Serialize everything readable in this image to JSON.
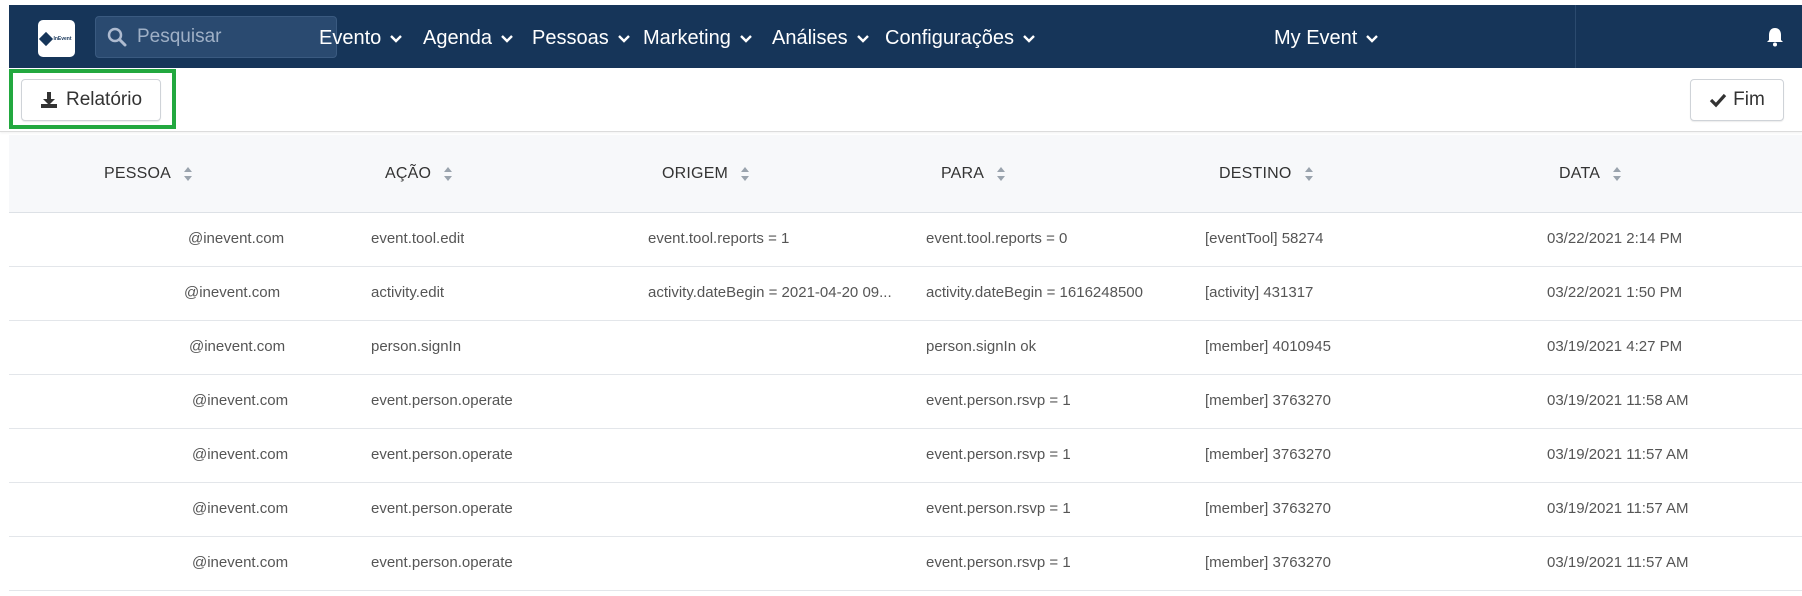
{
  "nav": {
    "logo_text": "InEvent",
    "search_placeholder": "Pesquisar",
    "items": [
      {
        "label": "Evento"
      },
      {
        "label": "Agenda"
      },
      {
        "label": "Pessoas"
      },
      {
        "label": "Marketing"
      },
      {
        "label": "Análises"
      },
      {
        "label": "Configurações"
      }
    ],
    "event_selector": "My Event"
  },
  "toolbar": {
    "report_label": "Relatório",
    "end_label": "Fim"
  },
  "table": {
    "columns": [
      "PESSOA",
      "AÇÃO",
      "ORIGEM",
      "PARA",
      "DESTINO",
      "DATA"
    ],
    "rows": [
      {
        "pessoa": "@inevent.com",
        "acao": "event.tool.edit",
        "origem": "event.tool.reports = 1",
        "para": "event.tool.reports = 0",
        "destino": "[eventTool] 58274",
        "data": "03/22/2021 2:14 PM"
      },
      {
        "pessoa": "@inevent.com",
        "acao": "activity.edit",
        "origem": "activity.dateBegin = 2021-04-20 09...",
        "para": "activity.dateBegin = 1616248500",
        "destino": "[activity] 431317",
        "data": "03/22/2021 1:50 PM"
      },
      {
        "pessoa": "@inevent.com",
        "acao": "person.signIn",
        "origem": "",
        "para": "person.signIn ok",
        "destino": "[member] 4010945",
        "data": "03/19/2021 4:27 PM"
      },
      {
        "pessoa": "@inevent.com",
        "acao": "event.person.operate",
        "origem": "",
        "para": "event.person.rsvp = 1",
        "destino": "[member] 3763270",
        "data": "03/19/2021 11:58 AM"
      },
      {
        "pessoa": "@inevent.com",
        "acao": "event.person.operate",
        "origem": "",
        "para": "event.person.rsvp = 1",
        "destino": "[member] 3763270",
        "data": "03/19/2021 11:57 AM"
      },
      {
        "pessoa": "@inevent.com",
        "acao": "event.person.operate",
        "origem": "",
        "para": "event.person.rsvp = 1",
        "destino": "[member] 3763270",
        "data": "03/19/2021 11:57 AM"
      },
      {
        "pessoa": "@inevent.com",
        "acao": "event.person.operate",
        "origem": "",
        "para": "event.person.rsvp = 1",
        "destino": "[member] 3763270",
        "data": "03/19/2021 11:57 AM"
      }
    ]
  },
  "colors": {
    "nav_bg": "#163559",
    "highlight": "#22a83f"
  }
}
